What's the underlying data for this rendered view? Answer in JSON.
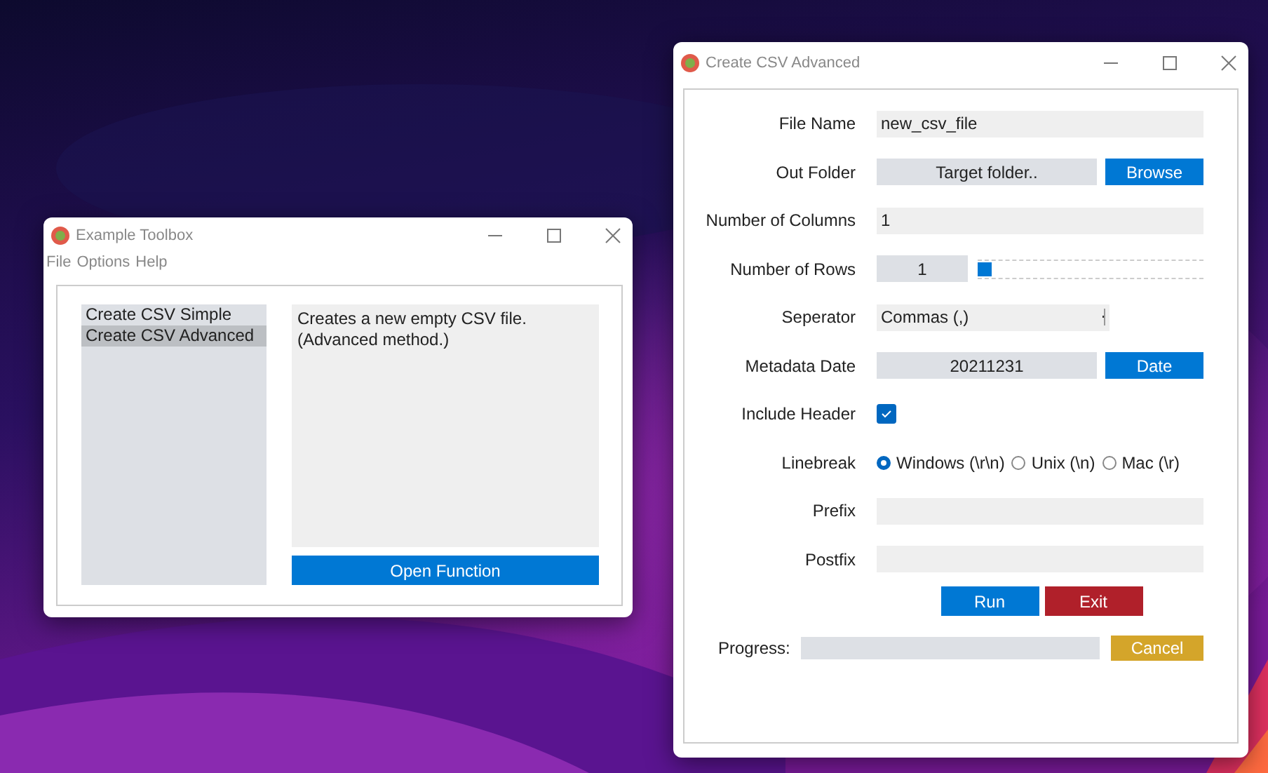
{
  "toolbox_window": {
    "title": "Example Toolbox",
    "menu": [
      "File",
      "Options",
      "Help"
    ],
    "functions": [
      {
        "label": "Create CSV Simple",
        "selected": false
      },
      {
        "label": "Create CSV Advanced",
        "selected": true
      }
    ],
    "description": "Creates a new empty CSV file. (Advanced method.)",
    "open_button": "Open Function"
  },
  "advanced_window": {
    "title": "Create CSV Advanced",
    "rows": [
      {
        "kind": "text",
        "label": "File Name",
        "value": "new_csv_file"
      },
      {
        "kind": "button_field",
        "label": "Out Folder",
        "value": "Target folder..",
        "button": "Browse"
      },
      {
        "kind": "text",
        "label": "Number of Columns",
        "value": "1"
      },
      {
        "kind": "spin_slider",
        "label": "Number of Rows",
        "value": "1",
        "level": 0
      },
      {
        "kind": "select",
        "label": "Seperator",
        "value": "Commas (,)"
      },
      {
        "kind": "button_field",
        "label": "Metadata Date",
        "value": "20211231",
        "button": "Date"
      },
      {
        "kind": "checkbox",
        "label": "Include Header",
        "checked": true
      },
      {
        "kind": "radio",
        "label": "Linebreak",
        "options": [
          {
            "label": "Windows (\\r\\n)",
            "selected": true
          },
          {
            "label": "Unix (\\n)",
            "selected": false
          },
          {
            "label": "Mac (\\r)",
            "selected": false
          }
        ]
      },
      {
        "kind": "text",
        "label": "Prefix"
      },
      {
        "kind": "text",
        "label": "Postfix"
      }
    ],
    "run_button": "Run",
    "exit_button": "Exit",
    "progress": {
      "label": "Progress:",
      "level": 0
    },
    "cancel_button": "Cancel"
  }
}
